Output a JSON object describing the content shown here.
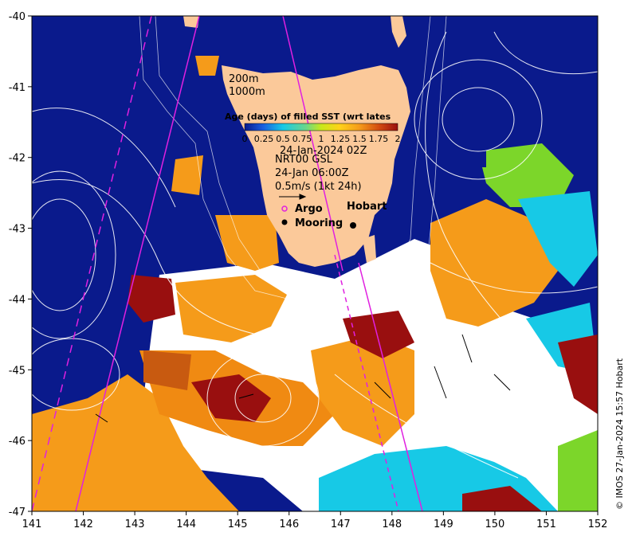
{
  "map": {
    "lon_range": [
      141,
      152
    ],
    "lat_range": [
      -47,
      -40
    ],
    "x_ticks": [
      "141",
      "142",
      "143",
      "144",
      "145",
      "146",
      "147",
      "148",
      "149",
      "150",
      "151",
      "152"
    ],
    "y_ticks": [
      "-40",
      "-41",
      "-42",
      "-43",
      "-44",
      "-45",
      "-46",
      "-47"
    ],
    "colors": {
      "ocean_base": "#0a1a8c",
      "land": "#fbc99a",
      "cloud_gap": "#ffffff",
      "age_recent_orange": "#f59b1a",
      "age_dark_red": "#990f0f",
      "age_cyan": "#17c9e6",
      "age_green": "#7cd62a",
      "contour": "#ffffff",
      "track": "#e020e0"
    }
  },
  "legend": {
    "depth_labels": [
      "200m",
      "1000m"
    ],
    "colorbar_title": "Age (days) of filled SST (wrt lates",
    "colorbar_ticks": [
      "0",
      "0.25",
      "0.5",
      "0.75",
      "1",
      "1.25",
      "1.5",
      "1.75",
      "2"
    ],
    "date_label": "24-Jan-2024 02Z",
    "product_label": "NRT00 GSL",
    "time_label": "24-Jan 06:00Z",
    "scale_label": "0.5m/s (1kt 24h)",
    "argo_label": "Argo",
    "mooring_label": "Mooring",
    "city_label": "Hobart"
  },
  "credit": "© IMOS 27-Jan-2024 15:57 Hobart"
}
